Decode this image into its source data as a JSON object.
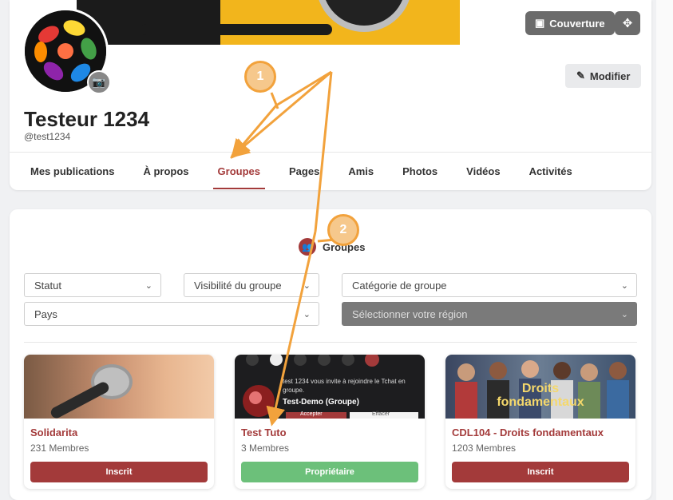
{
  "profile": {
    "cover_button_label": "Couverture",
    "edit_button_label": "Modifier",
    "name": "Testeur 1234",
    "handle": "@test1234"
  },
  "tabs": [
    {
      "label": "Mes publications"
    },
    {
      "label": "À propos"
    },
    {
      "label": "Groupes",
      "active": true
    },
    {
      "label": "Pages"
    },
    {
      "label": "Amis"
    },
    {
      "label": "Photos"
    },
    {
      "label": "Vidéos"
    },
    {
      "label": "Activités"
    }
  ],
  "groups_section": {
    "title": "Groupes",
    "filters": {
      "status": "Statut",
      "visibility": "Visibilité du groupe",
      "category": "Catégorie de groupe",
      "country": "Pays",
      "region_placeholder": "Sélectionner votre région"
    }
  },
  "groups": [
    {
      "name": "Solidarita",
      "members": "231 Membres",
      "action": "Inscrit",
      "action_color": "#a33a3a"
    },
    {
      "name": "Test Tuto",
      "members": "3 Membres",
      "action": "Propriétaire",
      "action_color": "#6cc07a",
      "preview": {
        "notification": "test 1234 vous invite à rejoindre le Tchat en groupe.",
        "group": "Test-Demo (Groupe)",
        "accept": "Accepter",
        "decline": "Effacer"
      }
    },
    {
      "name": "CDL104 - Droits fondamentaux",
      "members": "1203 Membres",
      "action": "Inscrit",
      "action_color": "#a33a3a",
      "image_text": "Droits fondamentaux"
    }
  ],
  "annotations": {
    "badge_1": "1",
    "badge_2": "2"
  },
  "colors": {
    "accent": "#a33a3a",
    "arrow": "#f2a23c",
    "owner": "#6cc07a"
  }
}
